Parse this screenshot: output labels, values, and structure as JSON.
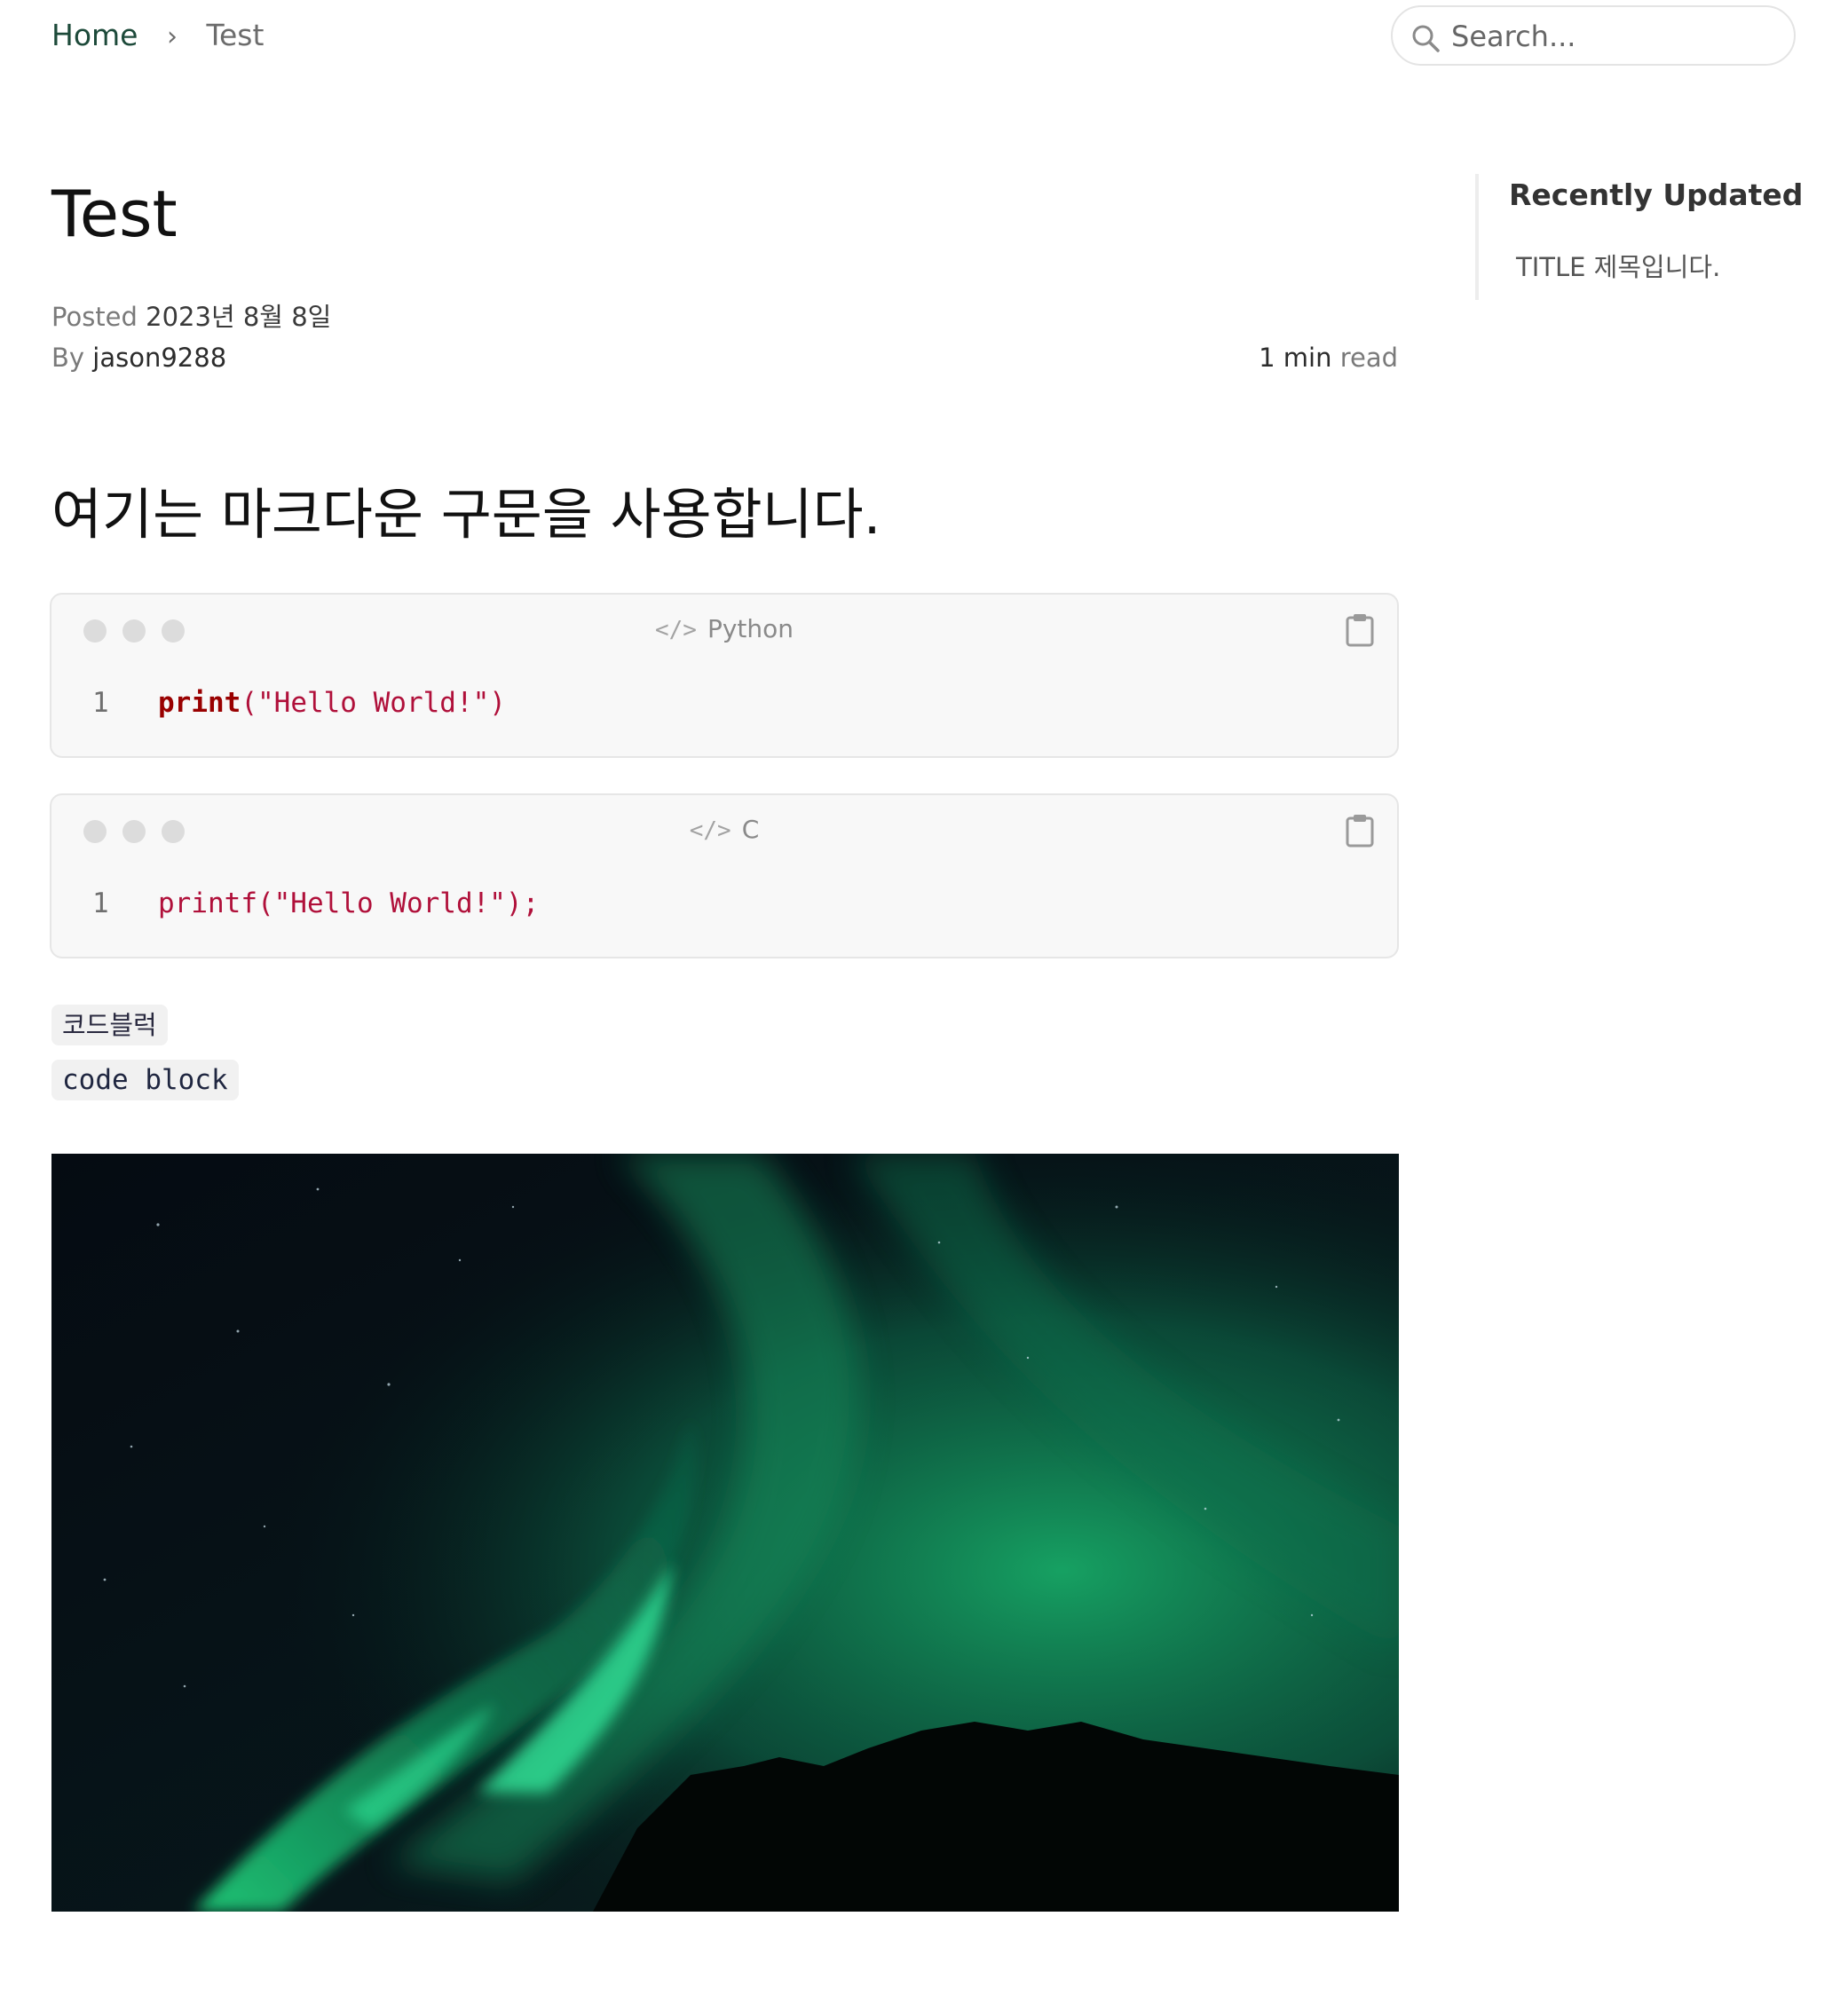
{
  "breadcrumb": {
    "home": "Home",
    "separator": "›",
    "current": "Test"
  },
  "search": {
    "placeholder": "Search..."
  },
  "post": {
    "title": "Test",
    "posted_label": "Posted",
    "posted_date": "2023년 8월 8일",
    "by_label": "By",
    "author": "jason9288",
    "read_value": "1 min",
    "read_label": "read"
  },
  "content": {
    "heading": "여기는 마크다운 구문을 사용합니다.",
    "code_blocks": [
      {
        "language": "Python",
        "line_number": "1",
        "keyword": "print",
        "rest": "(\"Hello World!\")"
      },
      {
        "language": "C",
        "line_number": "1",
        "code": "printf(\"Hello World!\");"
      }
    ],
    "tag_korean": "코드블럭",
    "tag_english": "code block"
  },
  "sidebar": {
    "title": "Recently Updated",
    "items": [
      {
        "label": "TITLE 제목입니다."
      }
    ]
  },
  "colors": {
    "accent": "#1d4a3a",
    "code_keyword": "#990000",
    "code_string": "#b0103a",
    "aurora_green": "#1fd87f"
  },
  "icons": {
    "search": "search-icon",
    "code": "code-icon",
    "copy": "clipboard-icon"
  }
}
